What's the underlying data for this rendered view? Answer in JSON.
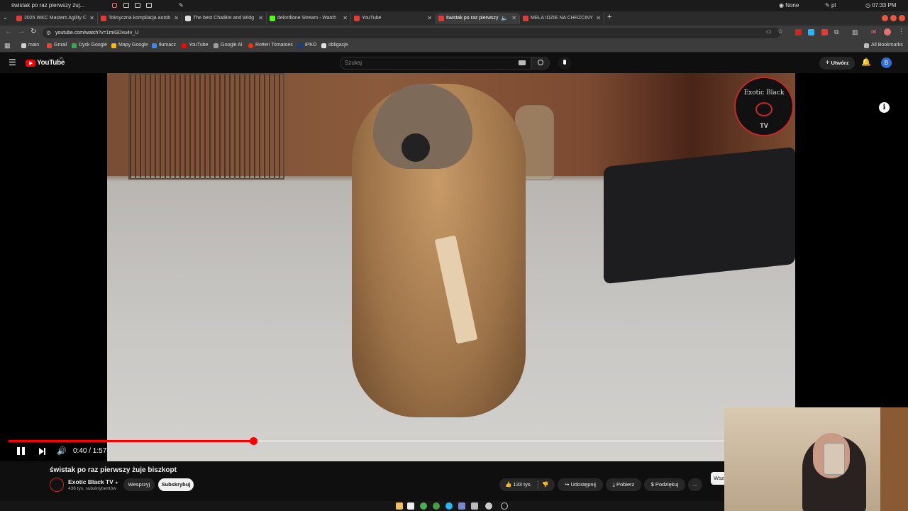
{
  "os": {
    "window_title": "świstak po raz pierwszy żuj...",
    "network": "None",
    "keyboard": "pl",
    "clock": "07:33 PM"
  },
  "tabs": [
    {
      "label": "2025 WKC Masters Agility C",
      "fav_color": "#e53935"
    },
    {
      "label": "Toksyczna kompilacja autob",
      "fav_color": "#e53935"
    },
    {
      "label": "The best ChatBot and Widg",
      "fav_color": "#e0e0e0"
    },
    {
      "label": "delordione Stream - Watch",
      "fav_color": "#53fc18"
    },
    {
      "label": "YouTube",
      "fav_color": "#e53935"
    },
    {
      "label": "świstak po raz pierwszy",
      "fav_color": "#e53935"
    },
    {
      "label": "MELA IDZIE NA CHRZCINY",
      "fav_color": "#e53935"
    }
  ],
  "address": {
    "url": "youtube.com/watch?v=1miGDvu4v_U"
  },
  "bookmarks": {
    "items": [
      {
        "label": "main",
        "color": "#cfcfcf"
      },
      {
        "label": "Gmail",
        "color": "#ea4335"
      },
      {
        "label": "Dysk Google",
        "color": "#34a853"
      },
      {
        "label": "Mapy Google",
        "color": "#fbbc05"
      },
      {
        "label": "tłumacz",
        "color": "#4285f4"
      },
      {
        "label": "YouTube",
        "color": "#ff0000"
      },
      {
        "label": "Google AI",
        "color": "#9e9e9e"
      },
      {
        "label": "Rotten Tomatoes",
        "color": "#fa320a"
      },
      {
        "label": "iPKO",
        "color": "#1a3d7c"
      },
      {
        "label": "obligacje",
        "color": "#e0e0e0"
      }
    ],
    "all_label": "All Bookmarks"
  },
  "youtube": {
    "logo_text": "YouTube",
    "region": "PL",
    "search_placeholder": "Szukaj",
    "create_label": "Utwórz",
    "avatar_letter": "B"
  },
  "video": {
    "watermark_line1": "Exotic Black",
    "watermark_line2": "TV",
    "current_time": "0:40",
    "duration": "1:57",
    "time_display": "0:40 / 1:57",
    "progress_fraction": 0.342
  },
  "meta": {
    "title": "świstak po raz pierwszy żuje biszkopt",
    "channel": "Exotic Black TV",
    "subscribers": "436 tys. subskrybentów",
    "join_label": "Wesprzyj",
    "subscribe_label": "Subskrybuj",
    "likes": "133 tys.",
    "share_label": "Udostępnij",
    "download_label": "Pobierz",
    "thanks_label": "Podziękuj",
    "more_label": "...",
    "overflow_pill": "Wsz"
  },
  "colors": {
    "accent": "#ff0000",
    "bg": "#0f0f0f"
  }
}
